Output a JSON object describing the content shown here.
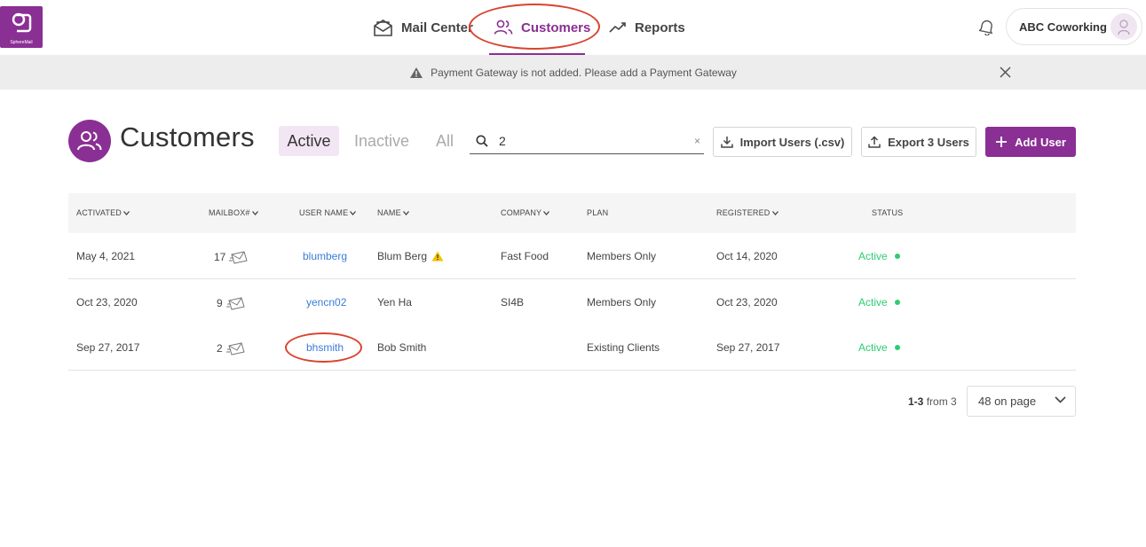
{
  "app": {
    "logo_text": "SphereMail",
    "brand_color": "#8a2f94",
    "annotation_color": "#d9442e"
  },
  "nav": {
    "items": [
      {
        "label": "Mail Center",
        "icon": "mail-icon"
      },
      {
        "label": "Customers",
        "icon": "users-icon",
        "active": true
      },
      {
        "label": "Reports",
        "icon": "chart-line-icon"
      }
    ]
  },
  "account": {
    "name": "ABC Coworking",
    "icon": "bell-icon"
  },
  "banner": {
    "text": "Payment Gateway is not added. Please add a  Payment Gateway",
    "icon": "warning-icon"
  },
  "page": {
    "title": "Customers",
    "filters": [
      "Active",
      "Inactive",
      "All"
    ],
    "active_filter": "Active",
    "search_value": "2",
    "search_clear": "×",
    "import_label": "Import Users (.csv)",
    "export_label": "Export 3 Users",
    "add_label": "Add User"
  },
  "table": {
    "columns": [
      "ACTIVATED",
      "MAILBOX#",
      "USER NAME",
      "NAME",
      "COMPANY",
      "PLAN",
      "REGISTERED",
      "STATUS"
    ],
    "rows": [
      {
        "activated": "May 4, 2021",
        "mailbox": "17",
        "username": "blumberg",
        "name": "Blum Berg",
        "name_warning": true,
        "company": "Fast Food",
        "plan": "Members Only",
        "registered": "Oct 14, 2020",
        "status": "Active"
      },
      {
        "activated": "Oct 23, 2020",
        "mailbox": "9",
        "username": "yencn02",
        "name": "Yen Ha",
        "company": "SI4B",
        "plan": "Members Only",
        "registered": "Oct 23, 2020",
        "status": "Active"
      },
      {
        "activated": "Sep 27, 2017",
        "mailbox": "2",
        "username": "bhsmith",
        "name": "Bob Smith",
        "company": "",
        "plan": "Existing Clients",
        "registered": "Sep 27, 2017",
        "status": "Active"
      }
    ]
  },
  "pagination": {
    "range": "1-3",
    "from_text": "from 3",
    "page_size": "48 on page"
  }
}
